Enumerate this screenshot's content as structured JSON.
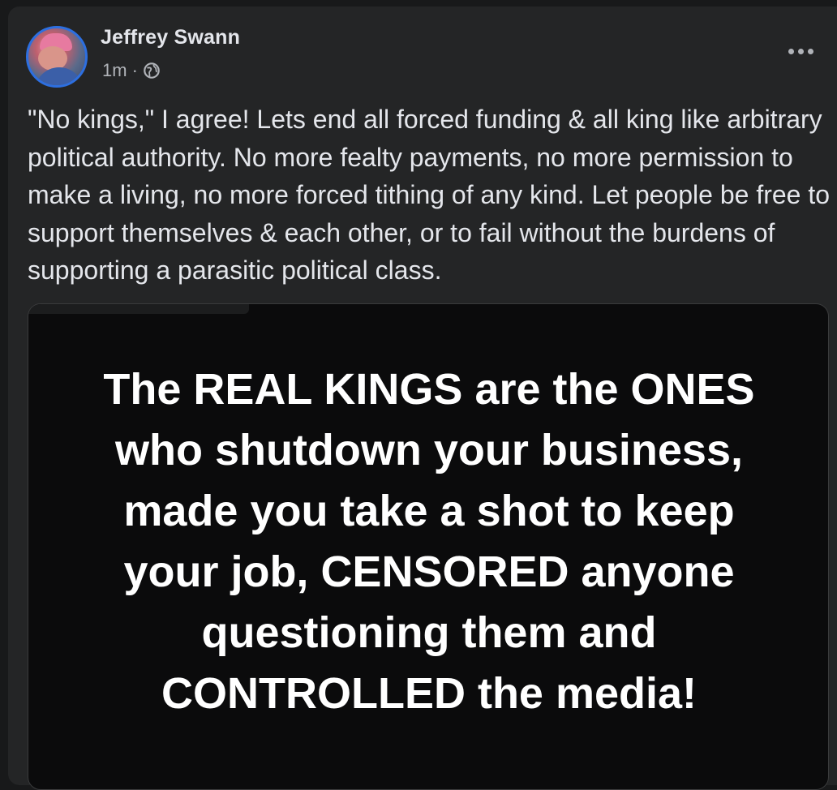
{
  "post": {
    "author": "Jeffrey Swann",
    "time": "1m",
    "separator": "·",
    "audience_icon": "globe-icon",
    "more_icon": "more-options-icon",
    "text": "\"No kings,\" I agree! Lets end all forced funding & all king like arbitrary political authority. No more fealty payments, no more permission to make a living, no more forced tithing of any kind. Let people be free to support themselves & each other, or to fail without the burdens of supporting a parasitic political class.",
    "image": {
      "text": "The REAL KINGS are the ONES\nwho shutdown your business,\nmade you take a shot to keep\nyour job,  CENSORED anyone\nquestioning them and\nCONTROLLED the media!"
    }
  },
  "colors": {
    "background": "#18191a",
    "card": "#242526",
    "primary_text": "#e4e6eb",
    "secondary_text": "#b0b3b8",
    "avatar_ring": "#2d6fe0",
    "image_bg": "#0b0b0c"
  }
}
